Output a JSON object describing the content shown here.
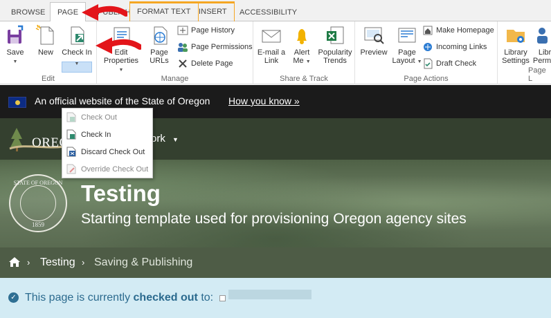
{
  "tabs": [
    {
      "label": "BROWSE",
      "active": false
    },
    {
      "label": "PAGE",
      "active": true
    },
    {
      "label": "PUBLISH",
      "active": false
    },
    {
      "label": "FORMAT TEXT",
      "active": false
    },
    {
      "label": "INSERT",
      "active": false
    },
    {
      "label": "ACCESSIBILITY",
      "active": false
    }
  ],
  "ribbon": {
    "edit": {
      "label": "Edit",
      "save": "Save",
      "new": "New",
      "check_in": "Check In"
    },
    "manage": {
      "label": "Manage",
      "edit_properties_line1": "Edit",
      "edit_properties_line2": "Properties",
      "page_urls_line1": "Page",
      "page_urls_line2": "URLs",
      "page_history": "Page History",
      "page_permissions": "Page Permissions",
      "delete_page": "Delete Page"
    },
    "share_track": {
      "label": "Share & Track",
      "email_line1": "E-mail a",
      "email_line2": "Link",
      "alert_line1": "Alert",
      "alert_line2": "Me",
      "popularity_line1": "Popularity",
      "popularity_line2": "Trends"
    },
    "page_actions": {
      "label": "Page Actions",
      "preview": "Preview",
      "page_layout_line1": "Page",
      "page_layout_line2": "Layout",
      "make_homepage": "Make Homepage",
      "incoming_links": "Incoming Links",
      "draft_check": "Draft Check"
    },
    "page_library": {
      "label": "Page L",
      "library_settings_line1": "Library",
      "library_settings_line2": "Settings",
      "library_permissions_line1": "Libr",
      "library_permissions_line2": "Permis"
    }
  },
  "checkin_menu": [
    {
      "label": "Check Out",
      "enabled": false
    },
    {
      "label": "Check In",
      "enabled": true
    },
    {
      "label": "Discard Check Out",
      "enabled": true
    },
    {
      "label": "Override Check Out",
      "enabled": false
    }
  ],
  "gov_banner": {
    "text": "An official website of the State of Oregon",
    "link": "How you know »"
  },
  "nav": {
    "logo": "OREGON",
    "item": "ork"
  },
  "hero": {
    "seal_top": "STATE OF OREGON",
    "seal_year": "1859",
    "title": "Testing",
    "subtitle": "Starting template used for provisioning Oregon agency sites"
  },
  "breadcrumb": {
    "items": [
      "Testing",
      "Saving & Publishing"
    ]
  },
  "status": {
    "prefix": "This page is currently ",
    "bold": "checked out",
    "suffix": " to:"
  },
  "colors": {
    "accent_orange": "#f5a623",
    "arrow_red": "#e3151a",
    "status_blue": "#2b6a8e"
  }
}
